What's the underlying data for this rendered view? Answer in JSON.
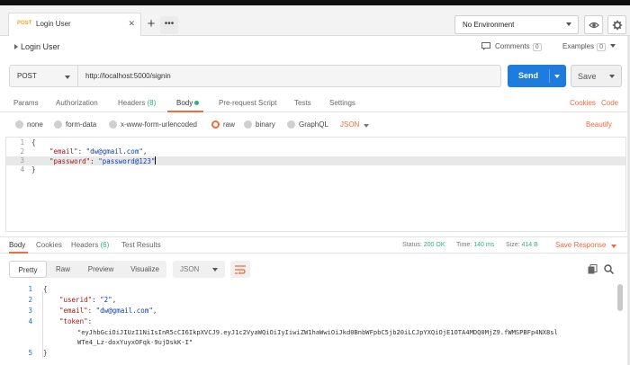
{
  "tab": {
    "method": "POST",
    "title": "Login User",
    "close": "✕"
  },
  "tabbar": {
    "plus": "+",
    "more": "•••"
  },
  "environment": {
    "label": "No Environment"
  },
  "request": {
    "title": "Login User",
    "comments_label": "Comments",
    "comments_count": "0",
    "examples_label": "Examples",
    "examples_count": "0",
    "method": "POST",
    "url": "http://localhost:5000/signin",
    "send_label": "Send",
    "save_label": "Save"
  },
  "request_tabs": {
    "params": "Params",
    "authorization": "Authorization",
    "headers": "Headers",
    "headers_count": "(8)",
    "body": "Body",
    "pre_request": "Pre-request Script",
    "tests": "Tests",
    "settings": "Settings",
    "cookies": "Cookies",
    "code": "Code"
  },
  "body_types": {
    "none": "none",
    "form_data": "form-data",
    "urlencoded": "x-www-form-urlencoded",
    "raw": "raw",
    "binary": "binary",
    "graphql": "GraphQL",
    "json": "JSON",
    "beautify": "Beautify"
  },
  "editor": {
    "lines": [
      {
        "no": "1",
        "open": "{"
      },
      {
        "no": "2",
        "key": "\"email\"",
        "sep": ": ",
        "val": "\"dw@gmail.com\"",
        "end": ","
      },
      {
        "no": "3",
        "key": "\"password\"",
        "sep": ": ",
        "val": "\"password@123\"",
        "end": ""
      },
      {
        "no": "4",
        "open": "}"
      }
    ]
  },
  "response_tabs": {
    "body": "Body",
    "cookies": "Cookies",
    "headers": "Headers",
    "headers_count": "(6)",
    "test_results": "Test Results",
    "status_label": "Status:",
    "status_value": "200 OK",
    "time_label": "Time:",
    "time_value": "140 ms",
    "size_label": "Size:",
    "size_value": "414 B",
    "save_response": "Save Response"
  },
  "response_toolbar": {
    "pretty": "Pretty",
    "raw": "Raw",
    "preview": "Preview",
    "visualize": "Visualize",
    "format": "JSON"
  },
  "response": {
    "l1": "{",
    "l2_key": "\"userid\"",
    "l2_val": "\"2\"",
    "l3_key": "\"email\"",
    "l3_val": "\"dw@gmail.com\"",
    "l4_key": "\"token\"",
    "token_line1": "\"eyJhbGciOiJIUzI1NiIsInR5cCI6IkpXVCJ9.eyJ1c2VyaWQiOiIyIiwiZW1haWwiOiJkd0BnbWFpbC5jb20iLCJpYXQiOjE1OTA4MDQ0MjZ9.fWMSPBFp4NX8sl",
    "token_line2": "WTe4_Lz-doxYuyxOFqk-9ujDskK-I\"",
    "l5": "}"
  },
  "colors": {
    "accent": "#f26b3a",
    "send": "#1d7cdd",
    "ok": "#26b47f",
    "key": "#a31515",
    "string": "#0b3ea8"
  }
}
